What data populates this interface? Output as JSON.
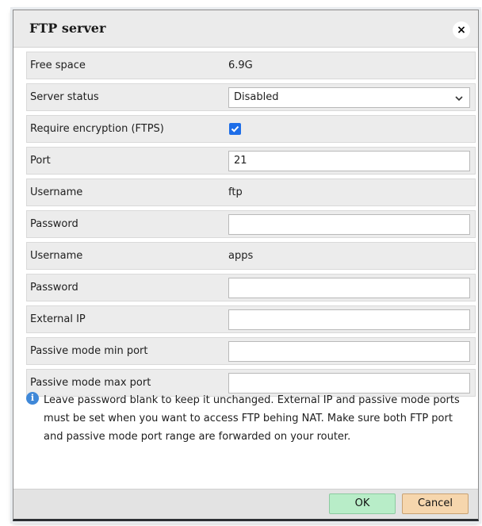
{
  "dialog": {
    "title": "FTP server",
    "close_glyph": "×"
  },
  "rows": {
    "free_space": {
      "label": "Free space",
      "value": "6.9G"
    },
    "server_status": {
      "label": "Server status",
      "value": "Disabled"
    },
    "require_encryption": {
      "label": "Require encryption (FTPS)",
      "checked": true
    },
    "port": {
      "label": "Port",
      "value": "21"
    },
    "username_ftp": {
      "label": "Username",
      "value": "ftp"
    },
    "password_ftp": {
      "label": "Password",
      "value": ""
    },
    "username_apps": {
      "label": "Username",
      "value": "apps"
    },
    "password_apps": {
      "label": "Password",
      "value": ""
    },
    "external_ip": {
      "label": "External IP",
      "value": ""
    },
    "passive_min": {
      "label": "Passive mode min port",
      "value": ""
    },
    "passive_max": {
      "label": "Passive mode max port",
      "value": ""
    }
  },
  "note": {
    "icon": "info-icon",
    "text": "Leave password blank to keep it unchanged. External IP and passive mode ports must be set when you want to access FTP behing NAT. Make sure both FTP port and passive mode port range are forwarded on your router."
  },
  "footer": {
    "ok_label": "OK",
    "cancel_label": "Cancel"
  },
  "colors": {
    "ok_button": "#b8edc8",
    "cancel_button": "#f6d6ad",
    "checkbox": "#1e6ee8",
    "info_icon": "#3f88d8"
  }
}
